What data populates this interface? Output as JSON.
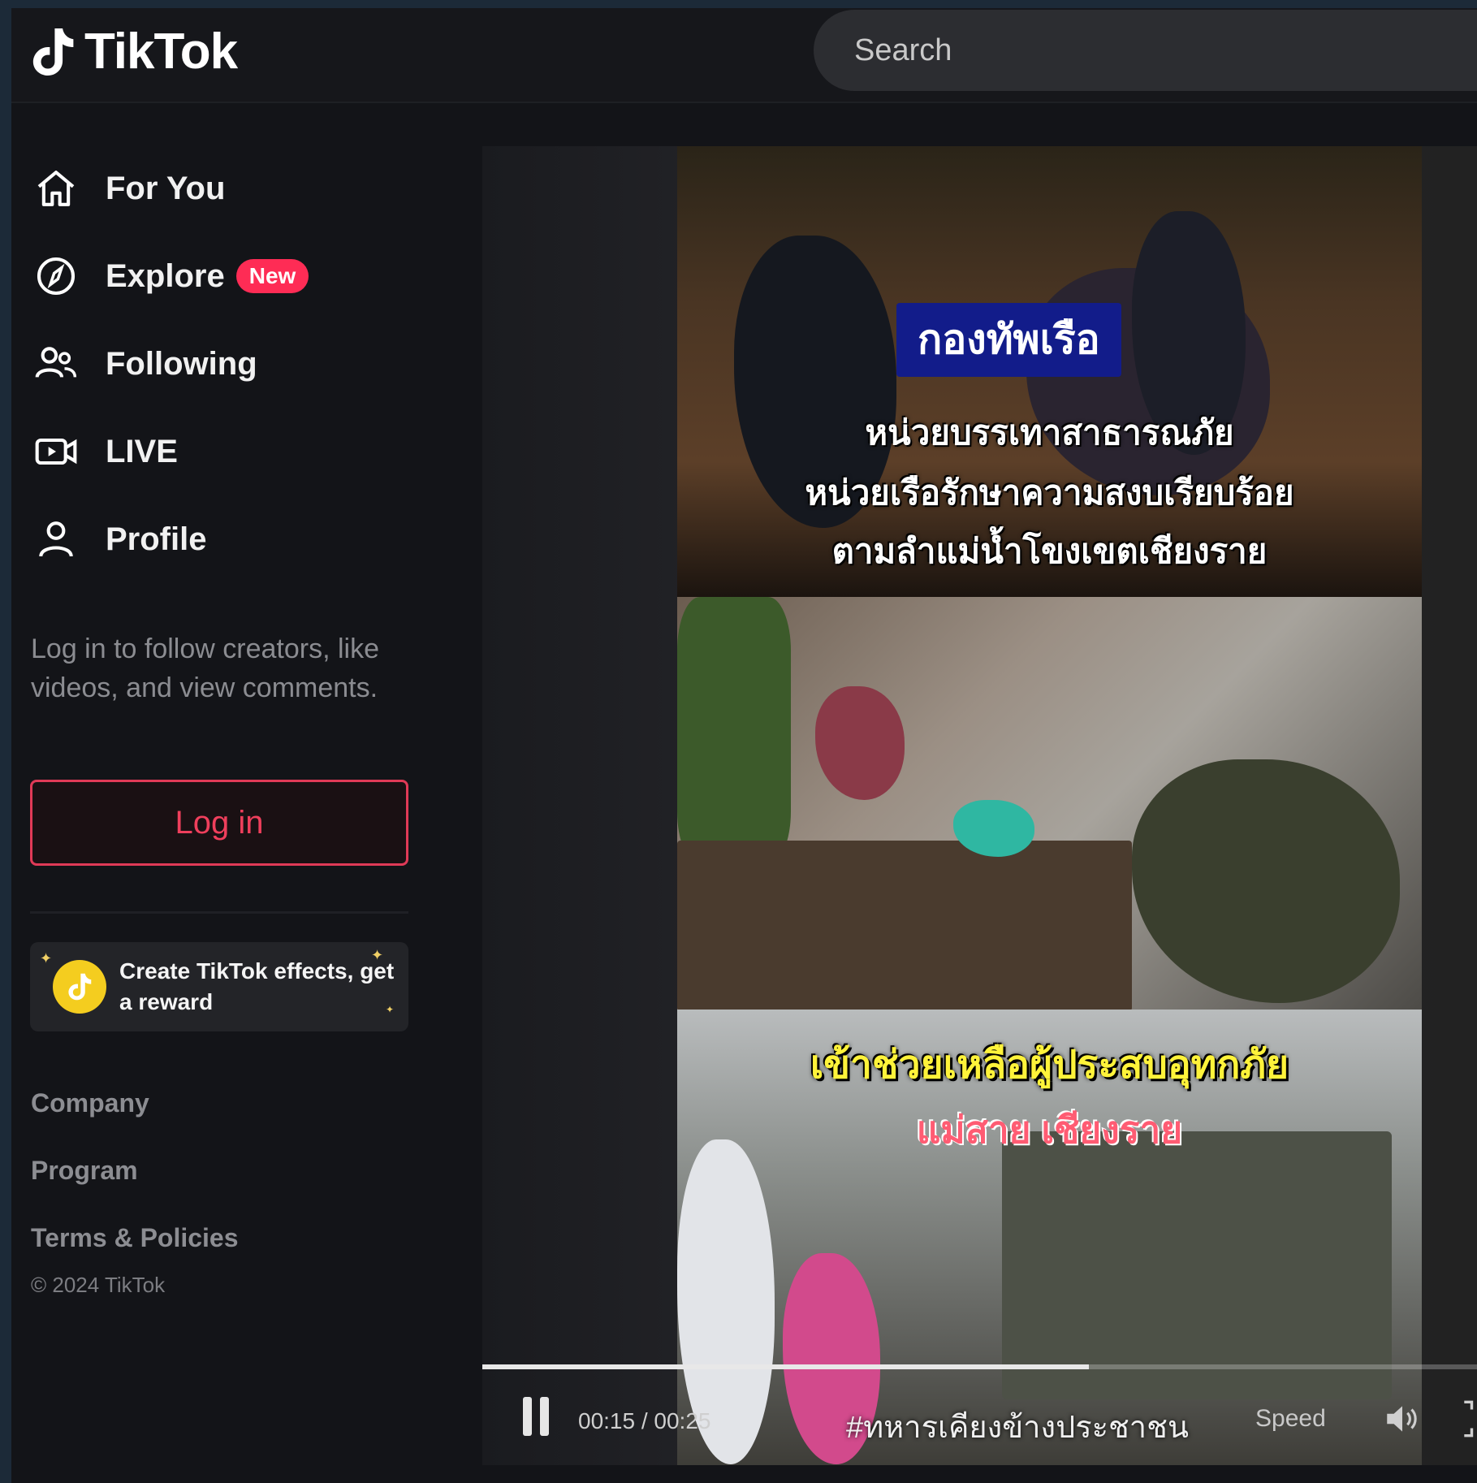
{
  "app": {
    "brand": "TikTok"
  },
  "search": {
    "placeholder": "Search"
  },
  "nav": {
    "for_you": "For You",
    "explore": "Explore",
    "explore_badge": "New",
    "following": "Following",
    "live": "LIVE",
    "profile": "Profile"
  },
  "login": {
    "hint": "Log in to follow creators, like videos, and view comments.",
    "button": "Log in"
  },
  "promo": {
    "text": "Create TikTok effects, get a reward"
  },
  "footer": {
    "company": "Company",
    "program": "Program",
    "terms": "Terms & Policies",
    "copyright": "© 2024 TikTok"
  },
  "video": {
    "caption_title": "กองทัพเรือ",
    "caption_line1": "หน่วยบรรเทาสาธารณภัย",
    "caption_line2": "หน่วยเรือรักษาความสงบเรียบร้อย",
    "caption_line3": "ตามลำแม่น้ำโขงเขตเชียงราย",
    "caption_help": "เข้าช่วยเหลือผู้ประสบอุทกภัย",
    "caption_place": "แม่สาย เชียงราย",
    "hashtag": "#ทหารเคียงข้างประชาชน",
    "time": "00:15 / 00:25",
    "progress": 0.61,
    "speed_label": "Speed"
  },
  "colors": {
    "accent": "#fe2c55",
    "background": "#131418"
  },
  "icons": [
    "tiktok-logo-icon",
    "home-icon",
    "compass-icon",
    "following-icon",
    "live-camera-icon",
    "profile-icon",
    "effects-icon",
    "pause-icon",
    "volume-icon",
    "fullscreen-icon"
  ]
}
